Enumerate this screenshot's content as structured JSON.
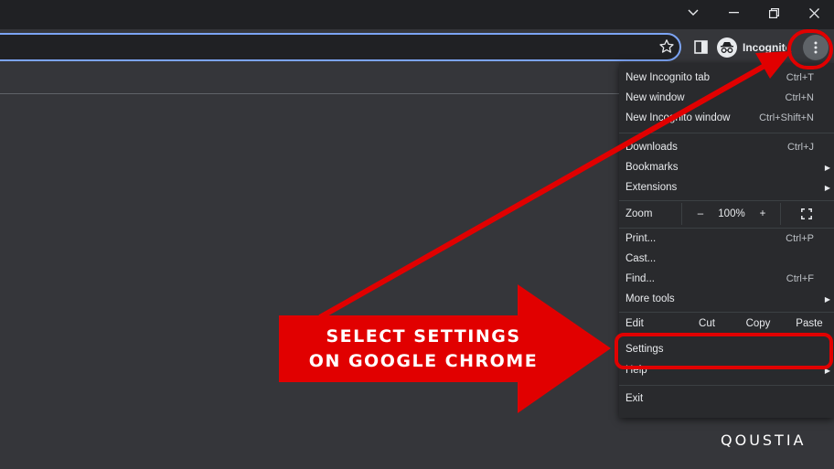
{
  "window_controls": {
    "chevron": "chevron-down-icon",
    "minimize": "minimize-icon",
    "restore": "restore-icon",
    "close": "close-icon"
  },
  "toolbar": {
    "incognito_label": "Incognito",
    "omnibox_border_color": "#7ca4f4"
  },
  "menu": {
    "new_incognito_tab": {
      "label": "New Incognito tab",
      "shortcut": "Ctrl+T"
    },
    "new_window": {
      "label": "New window",
      "shortcut": "Ctrl+N"
    },
    "new_incognito_window": {
      "label": "New Incognito window",
      "shortcut": "Ctrl+Shift+N"
    },
    "downloads": {
      "label": "Downloads",
      "shortcut": "Ctrl+J"
    },
    "bookmarks": {
      "label": "Bookmarks"
    },
    "extensions": {
      "label": "Extensions"
    },
    "zoom": {
      "label": "Zoom",
      "minus": "–",
      "value": "100%",
      "plus": "+"
    },
    "print": {
      "label": "Print...",
      "shortcut": "Ctrl+P"
    },
    "cast": {
      "label": "Cast..."
    },
    "find": {
      "label": "Find...",
      "shortcut": "Ctrl+F"
    },
    "more_tools": {
      "label": "More tools"
    },
    "edit": {
      "label": "Edit",
      "cut": "Cut",
      "copy": "Copy",
      "paste": "Paste"
    },
    "settings": {
      "label": "Settings"
    },
    "help": {
      "label": "Help"
    },
    "exit": {
      "label": "Exit"
    }
  },
  "annotation": {
    "callout_line1": "SELECT SETTINGS",
    "callout_line2": "ON GOOGLE CHROME",
    "highlight_color": "#e10000"
  },
  "watermark": "QOUSTIA"
}
